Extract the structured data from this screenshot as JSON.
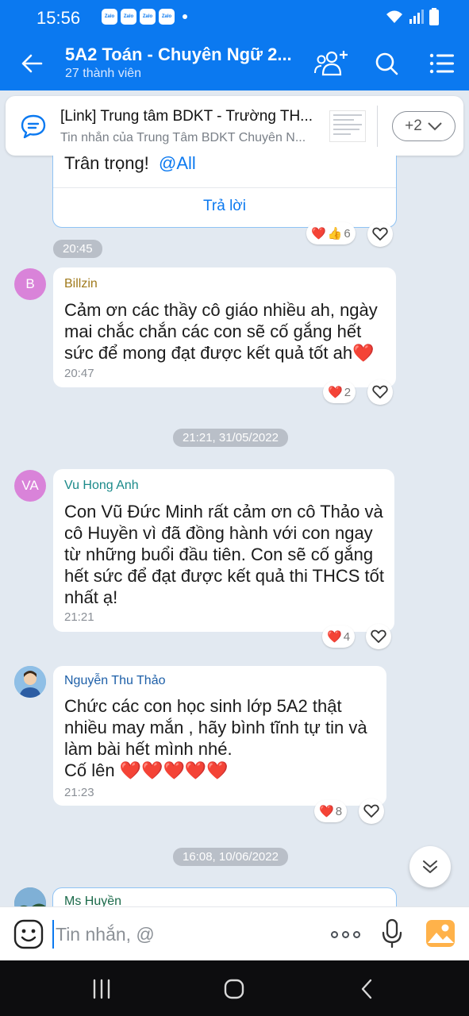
{
  "status_bar": {
    "time": "15:56",
    "app_badges": [
      "Zalo",
      "Zalo",
      "Zalo",
      "Zalo"
    ]
  },
  "header": {
    "title": "5A2 Toán - Chuyên Ngữ 2...",
    "subtitle": "27 thành viên"
  },
  "pinned": {
    "title": "[Link] Trung tâm BDKT - Trường TH...",
    "subtitle": "Tin nhắn của Trung Tâm BDKT Chuyên N...",
    "more_count": "+2"
  },
  "messages": [
    {
      "text": "Trân trọng!",
      "mention": "@All",
      "reply_label": "Trả lời",
      "reactions": {
        "heart": "❤️",
        "thumb": "👍",
        "count": "6"
      }
    },
    {
      "sender": "Billzin",
      "avatar_initials": "B",
      "text": "Cảm ơn các thầy cô giáo nhiều ah, ngày mai chắc chắn các con sẽ cố gắng hết sức để mong đạt được kết quả tốt ah❤️",
      "time": "20:47",
      "reactions": {
        "heart": "❤️",
        "count": "2"
      }
    },
    {
      "sender": "Vu Hong Anh",
      "avatar_initials": "VA",
      "text": "Con Vũ Đức Minh rất cảm ơn cô Thảo và cô Huyền vì đã đồng hành với con ngay từ những buổi đầu tiên. Con sẽ cố gắng hết sức để đạt được kết quả thi THCS tốt nhất ạ!",
      "time": "21:21",
      "reactions": {
        "heart": "❤️",
        "count": "4"
      }
    },
    {
      "sender": "Nguyễn Thu Thảo",
      "text": "Chức các con học sinh lớp 5A2 thật nhiều may mắn , hãy bình tĩnh tự tin và làm bài hết mình nhé.",
      "text2": "Cố lên ❤️❤️❤️❤️❤️",
      "time": "21:23",
      "reactions": {
        "heart": "❤️",
        "count": "8"
      }
    },
    {
      "sender": "Ms Huyền"
    }
  ],
  "time_separators": {
    "t1": "20:45",
    "t2": "21:21, 31/05/2022",
    "t3": "16:08, 10/06/2022"
  },
  "input": {
    "placeholder": "Tin nhắn, @"
  },
  "colors": {
    "brand": "#0b79f0",
    "chat_bg": "#e2e9f1",
    "heart": "#e8202e"
  },
  "icons": [
    "back-arrow-icon",
    "add-member-icon",
    "search-icon",
    "menu-list-icon",
    "chat-bubble-icon",
    "chevron-down-icon",
    "heart-icon",
    "emoji-icon",
    "mic-icon",
    "image-icon"
  ]
}
